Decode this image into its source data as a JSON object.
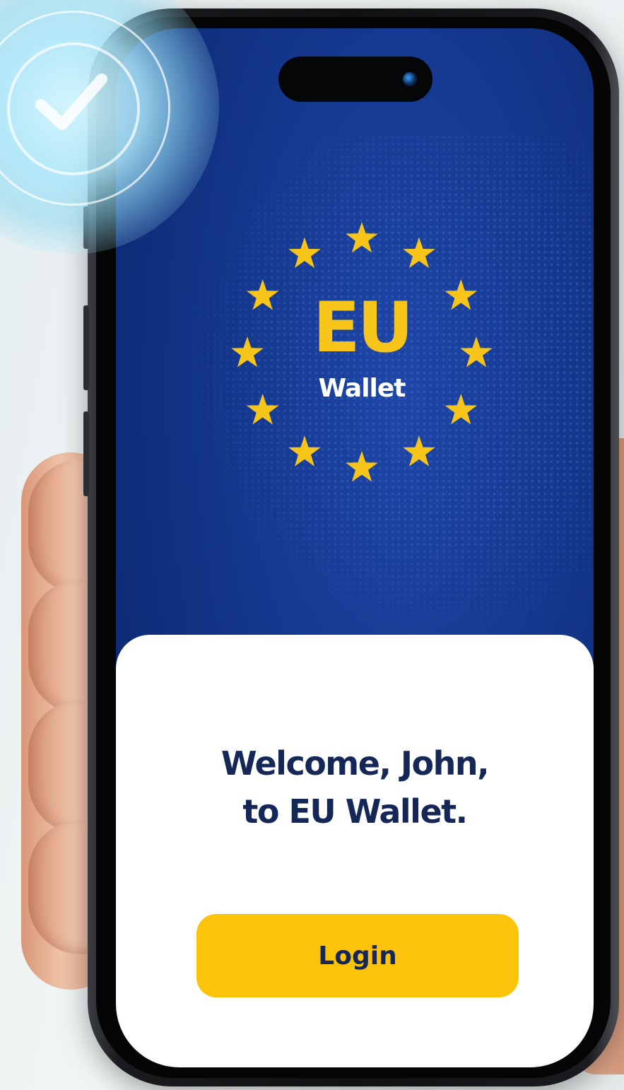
{
  "app": {
    "logo_title": "EU",
    "logo_subtitle": "Wallet"
  },
  "welcome": {
    "line1": "Welcome, John,",
    "line2": "to EU Wallet."
  },
  "actions": {
    "login_label": "Login"
  },
  "colors": {
    "brand_blue": "#163a92",
    "accent_yellow": "#fbc40a",
    "text_navy": "#142757"
  },
  "icons": [
    "eu-stars-icon",
    "verified-check-icon",
    "front-camera-icon"
  ]
}
